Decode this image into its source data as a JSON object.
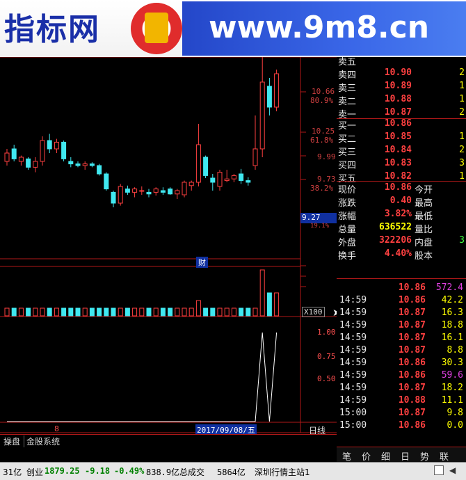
{
  "banner": {
    "logo_text": "指标网",
    "url_text": "www.9m8.cn"
  },
  "chart": {
    "price_labels": [
      {
        "value": "10.66",
        "pct": "80.9%"
      },
      {
        "value": "10.25",
        "pct": "61.8%"
      },
      {
        "value": "9.99",
        "pct": ""
      },
      {
        "value": "9.73",
        "pct": "38.2%"
      }
    ],
    "current_price_box": "9.27",
    "below_box_pct": "19.1%",
    "finance_marker": "财",
    "volume_scale": "X100",
    "indicator_ticks": [
      "1.00",
      "0.75",
      "0.50"
    ],
    "left_x_label": "8",
    "date_label": "2017/09/08/五",
    "period_label": "日线",
    "zoom_controls": [
      "+",
      "-",
      "0"
    ],
    "candles": [
      {
        "o": 9.95,
        "h": 10.1,
        "l": 9.9,
        "c": 10.05
      },
      {
        "o": 10.1,
        "h": 10.15,
        "l": 9.95,
        "c": 9.98
      },
      {
        "o": 9.95,
        "h": 10.02,
        "l": 9.9,
        "c": 10.0
      },
      {
        "o": 9.98,
        "h": 10.0,
        "l": 9.85,
        "c": 9.88
      },
      {
        "o": 9.88,
        "h": 10.0,
        "l": 9.82,
        "c": 9.95
      },
      {
        "o": 9.95,
        "h": 10.25,
        "l": 9.9,
        "c": 10.2
      },
      {
        "o": 10.2,
        "h": 10.28,
        "l": 10.05,
        "c": 10.1
      },
      {
        "o": 10.1,
        "h": 10.22,
        "l": 10.05,
        "c": 10.18
      },
      {
        "o": 10.18,
        "h": 10.2,
        "l": 9.95,
        "c": 9.98
      },
      {
        "o": 9.95,
        "h": 10.0,
        "l": 9.88,
        "c": 9.92
      },
      {
        "o": 9.92,
        "h": 9.95,
        "l": 9.88,
        "c": 9.9
      },
      {
        "o": 9.9,
        "h": 9.95,
        "l": 9.85,
        "c": 9.92
      },
      {
        "o": 9.92,
        "h": 9.94,
        "l": 9.88,
        "c": 9.9
      },
      {
        "o": 9.9,
        "h": 9.92,
        "l": 9.78,
        "c": 9.8
      },
      {
        "o": 9.8,
        "h": 9.82,
        "l": 9.6,
        "c": 9.62
      },
      {
        "o": 9.58,
        "h": 9.6,
        "l": 9.4,
        "c": 9.45
      },
      {
        "o": 9.45,
        "h": 9.68,
        "l": 9.42,
        "c": 9.65
      },
      {
        "o": 9.62,
        "h": 9.66,
        "l": 9.55,
        "c": 9.58
      },
      {
        "o": 9.58,
        "h": 9.64,
        "l": 9.52,
        "c": 9.62
      },
      {
        "o": 9.6,
        "h": 9.65,
        "l": 9.55,
        "c": 9.6
      },
      {
        "o": 9.58,
        "h": 9.62,
        "l": 9.52,
        "c": 9.56
      },
      {
        "o": 9.58,
        "h": 9.64,
        "l": 9.54,
        "c": 9.62
      },
      {
        "o": 9.6,
        "h": 9.64,
        "l": 9.55,
        "c": 9.58
      },
      {
        "o": 9.62,
        "h": 9.64,
        "l": 9.55,
        "c": 9.56
      },
      {
        "o": 9.56,
        "h": 9.62,
        "l": 9.5,
        "c": 9.6
      },
      {
        "o": 9.55,
        "h": 9.72,
        "l": 9.52,
        "c": 9.7
      },
      {
        "o": 9.66,
        "h": 9.72,
        "l": 9.6,
        "c": 9.7
      },
      {
        "o": 9.7,
        "h": 10.4,
        "l": 9.65,
        "c": 10.15
      },
      {
        "o": 10.0,
        "h": 10.02,
        "l": 9.75,
        "c": 9.78
      },
      {
        "o": 9.75,
        "h": 9.8,
        "l": 9.6,
        "c": 9.7
      },
      {
        "o": 9.65,
        "h": 9.85,
        "l": 9.6,
        "c": 9.82
      },
      {
        "o": 9.72,
        "h": 9.85,
        "l": 9.7,
        "c": 9.74
      },
      {
        "o": 9.74,
        "h": 9.8,
        "l": 9.7,
        "c": 9.78
      },
      {
        "o": 9.8,
        "h": 9.86,
        "l": 9.68,
        "c": 9.72
      },
      {
        "o": 9.72,
        "h": 9.76,
        "l": 9.66,
        "c": 9.7
      },
      {
        "o": 9.9,
        "h": 10.5,
        "l": 9.85,
        "c": 10.1
      },
      {
        "o": 10.1,
        "h": 11.2,
        "l": 10.0,
        "c": 10.9
      },
      {
        "o": 10.85,
        "h": 10.95,
        "l": 10.5,
        "c": 10.6
      },
      {
        "o": 10.6,
        "h": 11.05,
        "l": 10.55,
        "c": 11.0
      }
    ],
    "volumes": [
      1,
      1,
      1,
      1,
      1,
      1,
      1,
      1,
      1,
      1,
      1,
      1,
      1,
      1,
      1,
      1,
      1,
      1,
      1,
      1,
      1,
      1,
      1,
      1,
      1,
      1,
      1,
      2,
      1,
      1,
      1,
      1,
      1,
      1,
      1,
      1,
      6,
      3,
      3
    ],
    "indicator": [
      0,
      0,
      0,
      0,
      0,
      0,
      0,
      0,
      0,
      0,
      0,
      0,
      0,
      0,
      0,
      0,
      0,
      0,
      0,
      0,
      0,
      0,
      0,
      0,
      0,
      0,
      0,
      0,
      0,
      0,
      0,
      0,
      0,
      0,
      0,
      0,
      1,
      0,
      1
    ]
  },
  "order_book": [
    {
      "label": "卖五",
      "price": "",
      "vol": ""
    },
    {
      "label": "卖四",
      "price": "10.90",
      "vol": "2"
    },
    {
      "label": "卖三",
      "price": "10.89",
      "vol": "1"
    },
    {
      "label": "卖二",
      "price": "10.88",
      "vol": "1"
    },
    {
      "label": "卖一",
      "price": "10.87",
      "vol": "2"
    },
    {
      "label": "买一",
      "price": "10.86",
      "vol": ""
    },
    {
      "label": "买二",
      "price": "10.85",
      "vol": "1"
    },
    {
      "label": "买三",
      "price": "10.84",
      "vol": "2"
    },
    {
      "label": "买四",
      "price": "10.83",
      "vol": "3"
    },
    {
      "label": "买五",
      "price": "10.82",
      "vol": "1"
    }
  ],
  "stats": [
    {
      "label": "现价",
      "value": "10.86",
      "label2": "今开"
    },
    {
      "label": "涨跌",
      "value": "0.40",
      "label2": "最高"
    },
    {
      "label": "涨幅",
      "value": "3.82%",
      "label2": "最低"
    },
    {
      "label": "总量",
      "value": "636522",
      "label2": "量比"
    },
    {
      "label": "外盘",
      "value": "322206",
      "label2": "内盘",
      "value2": "3"
    },
    {
      "label": "换手",
      "value": "4.40%",
      "label2": "股本"
    }
  ],
  "ticks": [
    {
      "time": "",
      "price": "10.86",
      "vol": "572.4"
    },
    {
      "time": "14:59",
      "price": "10.86",
      "vol": "42.2"
    },
    {
      "time": "14:59",
      "price": "10.87",
      "vol": "16.3"
    },
    {
      "time": "14:59",
      "price": "10.87",
      "vol": "18.8"
    },
    {
      "time": "14:59",
      "price": "10.87",
      "vol": "16.1"
    },
    {
      "time": "14:59",
      "price": "10.87",
      "vol": "8.8"
    },
    {
      "time": "14:59",
      "price": "10.86",
      "vol": "30.3"
    },
    {
      "time": "14:59",
      "price": "10.86",
      "vol": "59.6"
    },
    {
      "time": "14:59",
      "price": "10.87",
      "vol": "18.2"
    },
    {
      "time": "14:59",
      "price": "10.88",
      "vol": "11.1"
    },
    {
      "time": "15:00",
      "price": "10.87",
      "vol": "9.8"
    },
    {
      "time": "15:00",
      "price": "10.86",
      "vol": "0.0"
    }
  ],
  "bottom_tabs": [
    "笔",
    "价",
    "细",
    "日",
    "势",
    "联"
  ],
  "left_tabs": [
    "操盘",
    "金股系统"
  ],
  "statusbar": {
    "left_fragment": "31亿",
    "index_name": "创业",
    "index_value": "1879.25",
    "index_change": "-9.18",
    "index_pct": "-0.49%",
    "index_turnover": "838.9亿",
    "total_label": "总成交",
    "total_value": "5864亿",
    "server": "深圳行情主站1"
  },
  "colors": {
    "up": "#ff4040",
    "down": "#40e8f0",
    "grid": "#b01818"
  }
}
